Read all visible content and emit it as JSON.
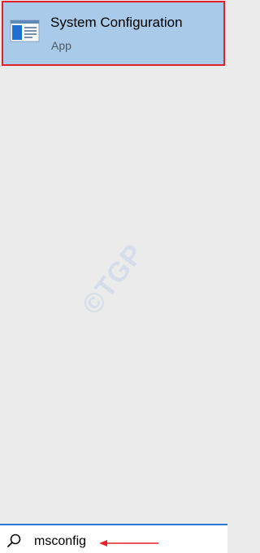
{
  "search_result": {
    "title": "System Configuration",
    "subtitle": "App",
    "icon": "system-configuration-app-icon"
  },
  "watermark": {
    "text": "©TGP"
  },
  "search_bar": {
    "query": "msconfig",
    "icon": "search-icon"
  },
  "colors": {
    "panel_background": "#ebebeb",
    "result_highlight": "#a9cbe9",
    "annotation_red": "#e0232b",
    "search_bar_accent": "#2b7bd6"
  }
}
